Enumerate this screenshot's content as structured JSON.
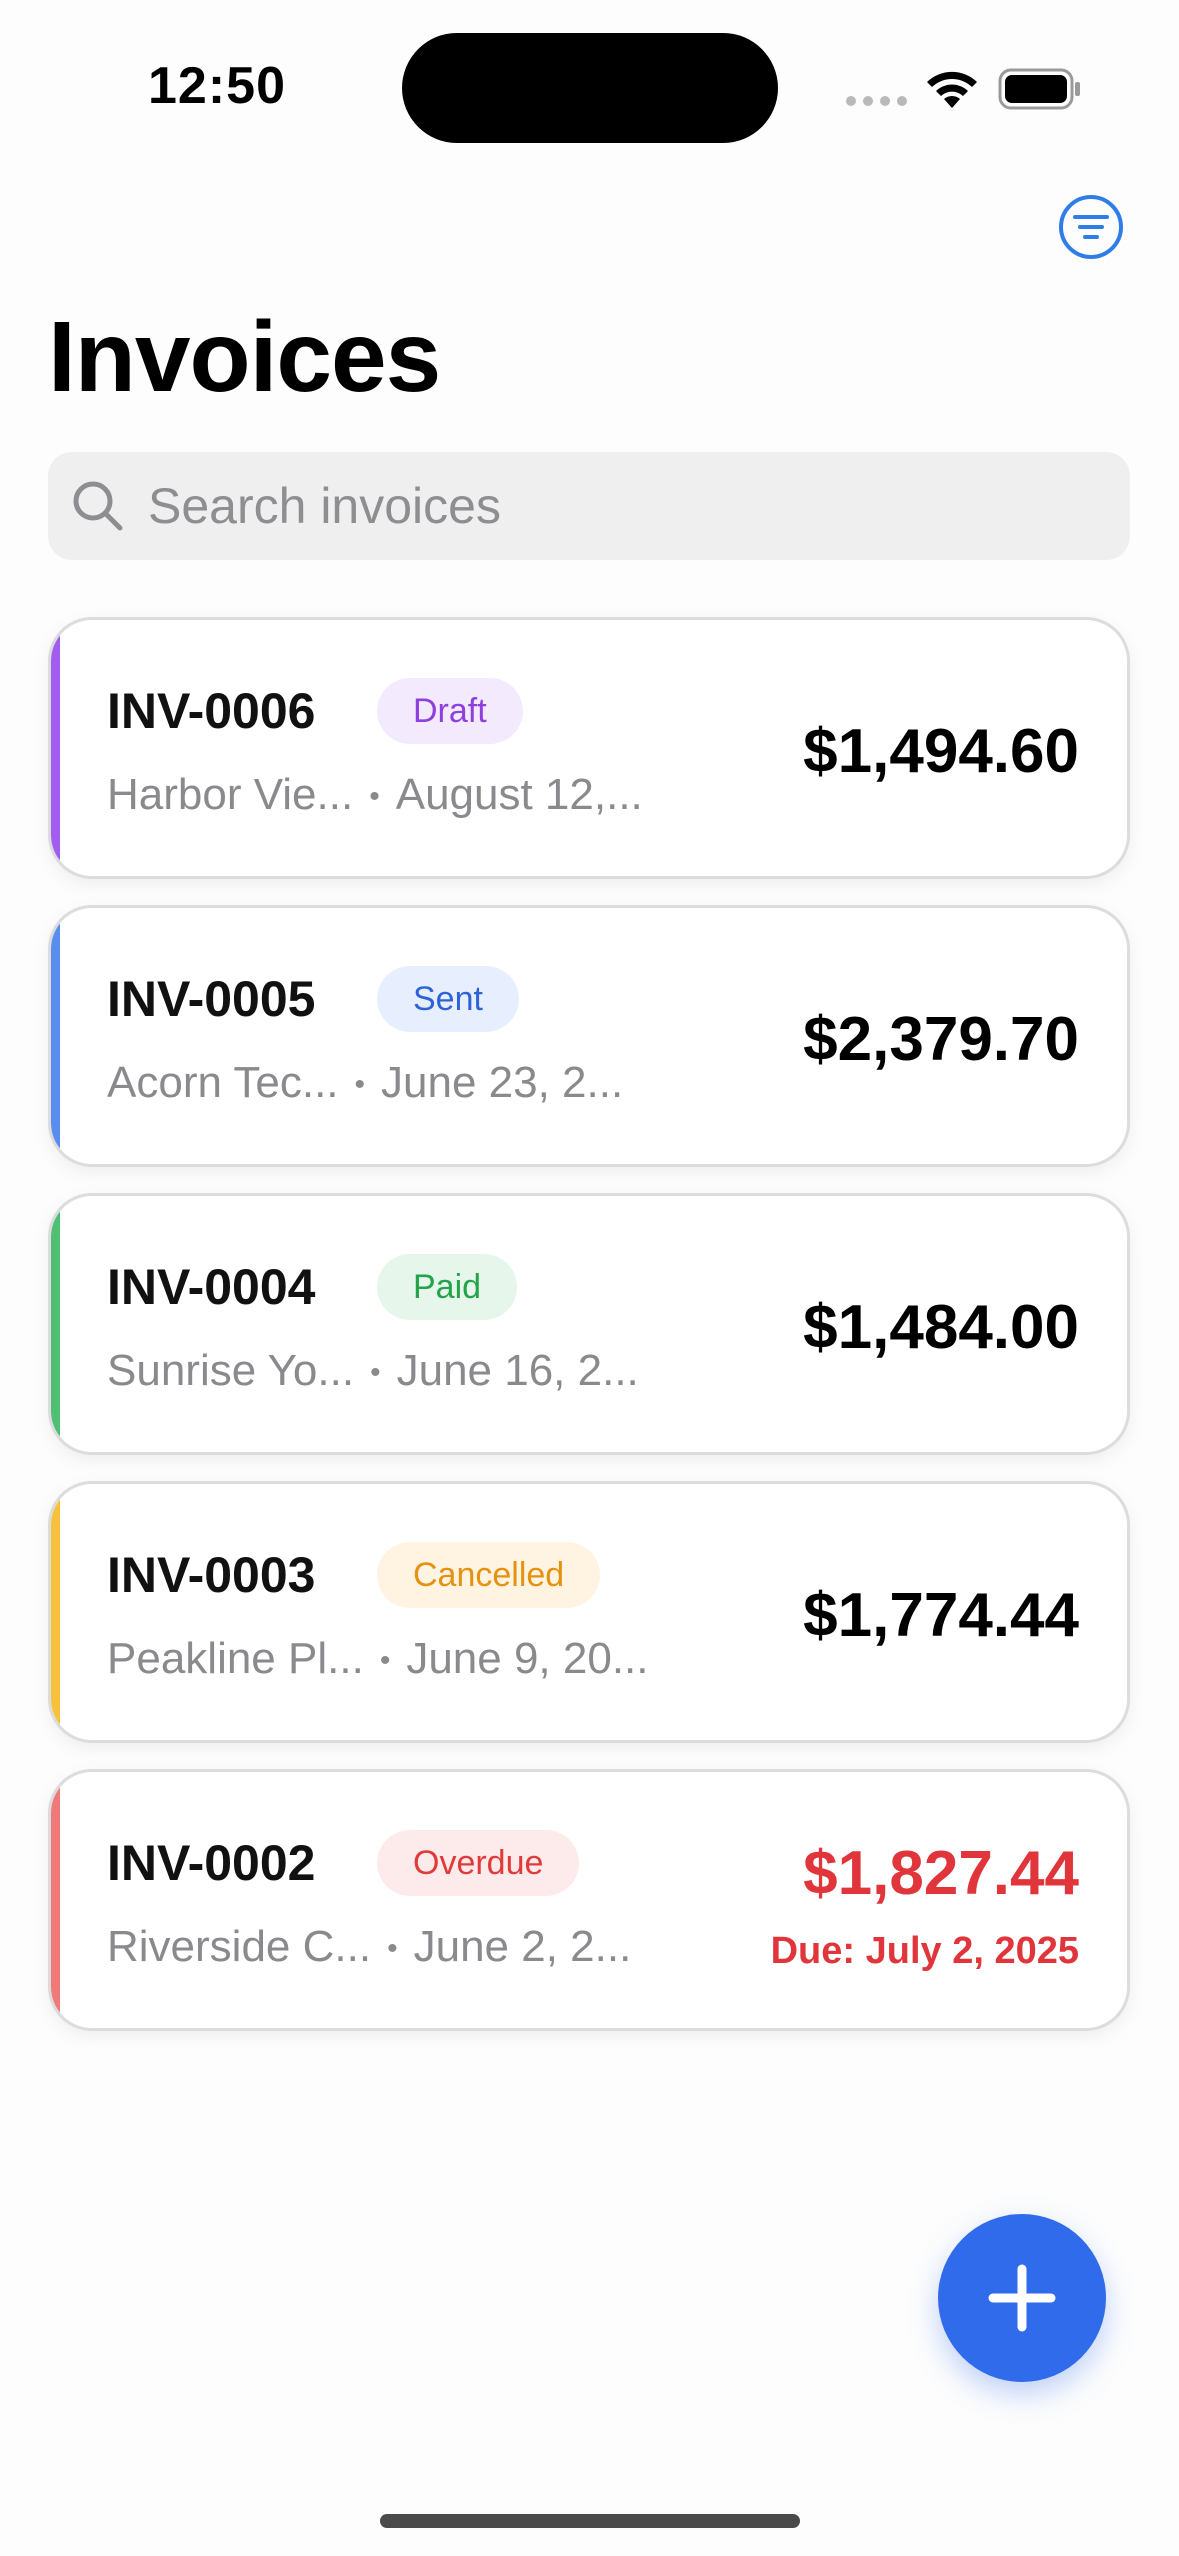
{
  "status_bar": {
    "time": "12:50"
  },
  "header": {
    "title": "Invoices"
  },
  "search": {
    "placeholder": "Search invoices"
  },
  "invoices": [
    {
      "id": "INV-0006",
      "status": "Draft",
      "client": "Harbor Vie...",
      "date": "August 12,...",
      "amount": "$1,494.60",
      "accent": "#a35cf0",
      "badge_bg": "#f3eafd",
      "badge_fg": "#8e3fe0"
    },
    {
      "id": "INV-0005",
      "status": "Sent",
      "client": "Acorn Tec...",
      "date": "June 23, 2...",
      "amount": "$2,379.70",
      "accent": "#5b8def",
      "badge_bg": "#e7efff",
      "badge_fg": "#2e63d8"
    },
    {
      "id": "INV-0004",
      "status": "Paid",
      "client": "Sunrise Yo...",
      "date": "June 16, 2...",
      "amount": "$1,484.00",
      "accent": "#4fbf73",
      "badge_bg": "#e6f6ea",
      "badge_fg": "#23a34a"
    },
    {
      "id": "INV-0003",
      "status": "Cancelled",
      "client": "Peakline Pl...",
      "date": "June 9, 20...",
      "amount": "$1,774.44",
      "accent": "#f6c23e",
      "badge_bg": "#fff4e2",
      "badge_fg": "#e6910f"
    },
    {
      "id": "INV-0002",
      "status": "Overdue",
      "client": "Riverside C...",
      "date": "June 2, 2...",
      "amount": "$1,827.44",
      "due": "Due: July 2, 2025",
      "accent": "#f07a7a",
      "badge_bg": "#fdebeb",
      "badge_fg": "#df3b3b"
    }
  ],
  "meta_separator": "•",
  "colors": {
    "accent": "#2f6bea",
    "overdue": "#e0353b"
  },
  "icons": {
    "filter": "filter-icon",
    "search": "search-icon",
    "add": "plus-icon"
  }
}
